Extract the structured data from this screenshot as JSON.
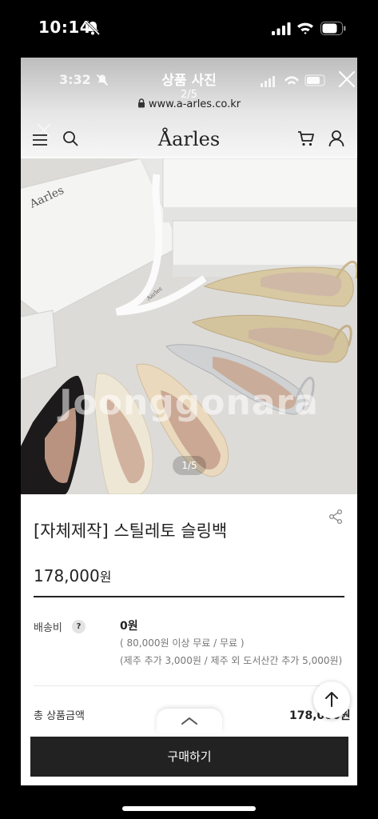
{
  "status_bar": {
    "time": "10:14"
  },
  "viewer": {
    "inner_time": "3:32",
    "title": "상품 사진",
    "counter": "2/5",
    "url": "www.a-arles.co.kr"
  },
  "site": {
    "logo": "Åarles"
  },
  "image": {
    "watermark": "Joonggonara",
    "counter": "1/5",
    "box_brand": "Aarles",
    "ribbon_text": "Aarles"
  },
  "product": {
    "name": "[자체제작] 스틸레토 슬링백",
    "price": "178,000",
    "price_unit": "원",
    "shipping_label": "배송비",
    "help": "?",
    "shipping_fee": "0원",
    "shipping_note_1": "( 80,000원 이상 무료 / 무료 )",
    "shipping_note_2": "(제주 추가 3,000원 / 제주 외 도서산간 추가 5,000원)",
    "total_label": "총 상품금액",
    "total_value": "178,000원"
  },
  "actions": {
    "buy": "구매하기"
  },
  "colors": {
    "buy_button": "#222222",
    "background": "#000000"
  }
}
